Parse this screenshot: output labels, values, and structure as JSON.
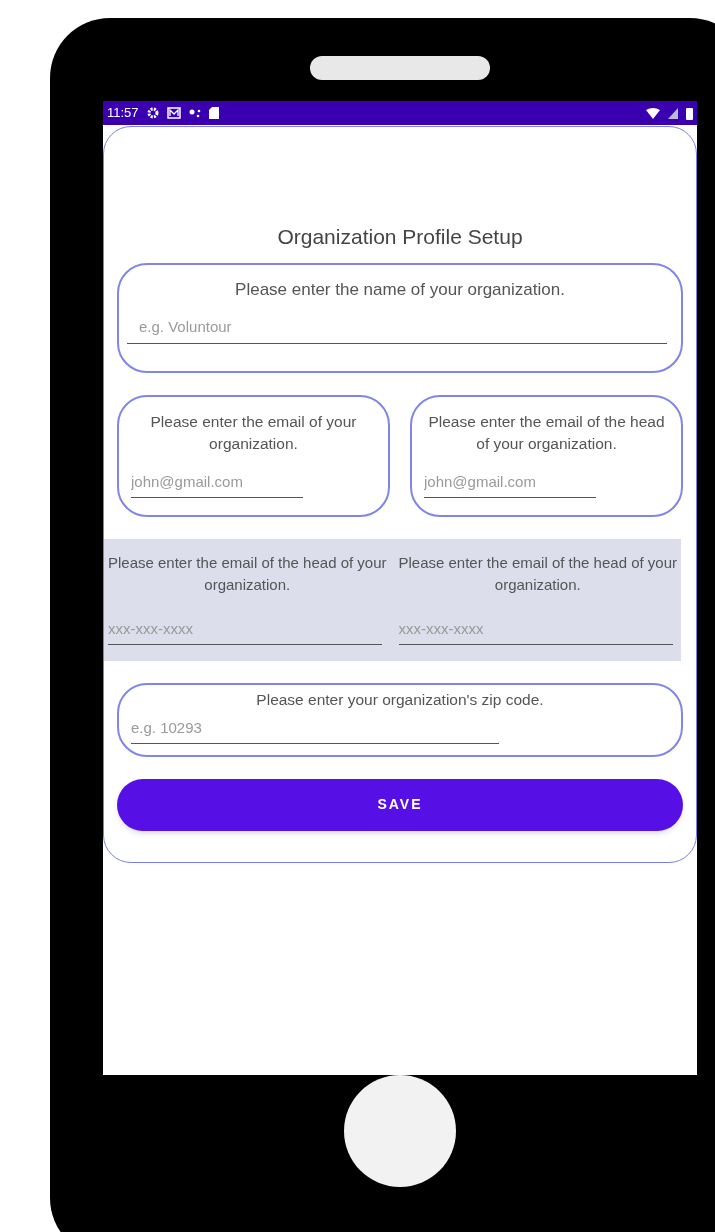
{
  "status_bar": {
    "time": "11:57"
  },
  "title": "Organization Profile Setup",
  "name_field": {
    "label": "Please enter the name of your organization.",
    "placeholder": "e.g. Voluntour"
  },
  "email_fields": [
    {
      "label": "Please enter the email of your organization.",
      "placeholder": "john@gmail.com"
    },
    {
      "label": "Please enter the email of the head of your organization.",
      "placeholder": "john@gmail.com"
    }
  ],
  "phone_fields": [
    {
      "label": "Please enter the email of the head of your organization.",
      "placeholder": "xxx-xxx-xxxx"
    },
    {
      "label": "Please enter the email of the head of your organization.",
      "placeholder": "xxx-xxx-xxxx"
    }
  ],
  "zip_field": {
    "label": "Please enter your organization's zip code.",
    "placeholder": "e.g. 10293"
  },
  "save_button": "SAVE"
}
